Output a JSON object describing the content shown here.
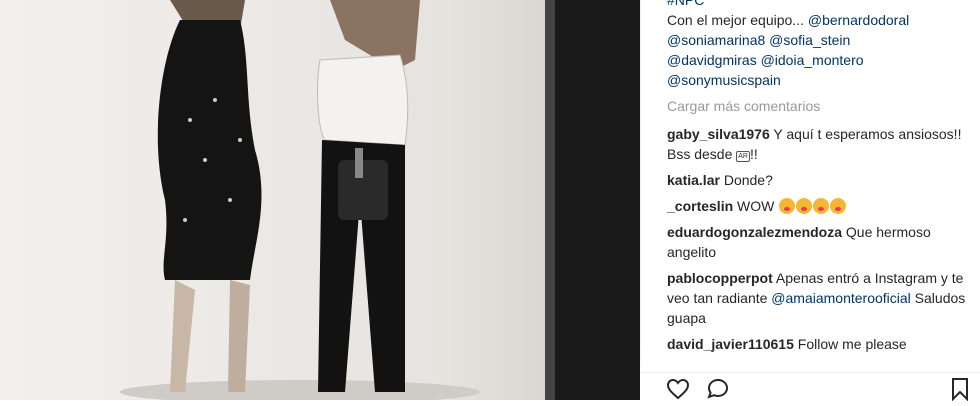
{
  "caption": {
    "hashtag": "#NPC",
    "text": "Con el mejor equipo... ",
    "mentions": [
      "@bernardodoral",
      "@soniamarina8",
      "@sofia_stein",
      "@davidgmiras",
      "@idoia_montero",
      "@sonymusicspain"
    ]
  },
  "load_more": "Cargar más comentarios",
  "comments": [
    {
      "user": "gaby_silva1976",
      "text": "Y aquí t esperamos ansiosos!! Bss desde ",
      "flag": "AR",
      "after": "!!"
    },
    {
      "user": "katia.lar",
      "text": "Donde?"
    },
    {
      "user": "_corteslin",
      "text": "WOW",
      "emoji_count": 4
    },
    {
      "user": "eduardogonzalezmendoza",
      "text": "Que hermoso angelito"
    },
    {
      "user": "pablocopperpot",
      "text": "Apenas entró a Instagram y te veo tan radiante ",
      "mention": "@amaiamonterooficial",
      "after": " Saludos guapa"
    },
    {
      "user": "david_javier110615",
      "text": "Follow me please"
    }
  ],
  "actions": [
    "heart-icon",
    "comment-icon",
    "bookmark-icon"
  ],
  "colors": {
    "mention": "#003569",
    "muted": "#999999"
  }
}
